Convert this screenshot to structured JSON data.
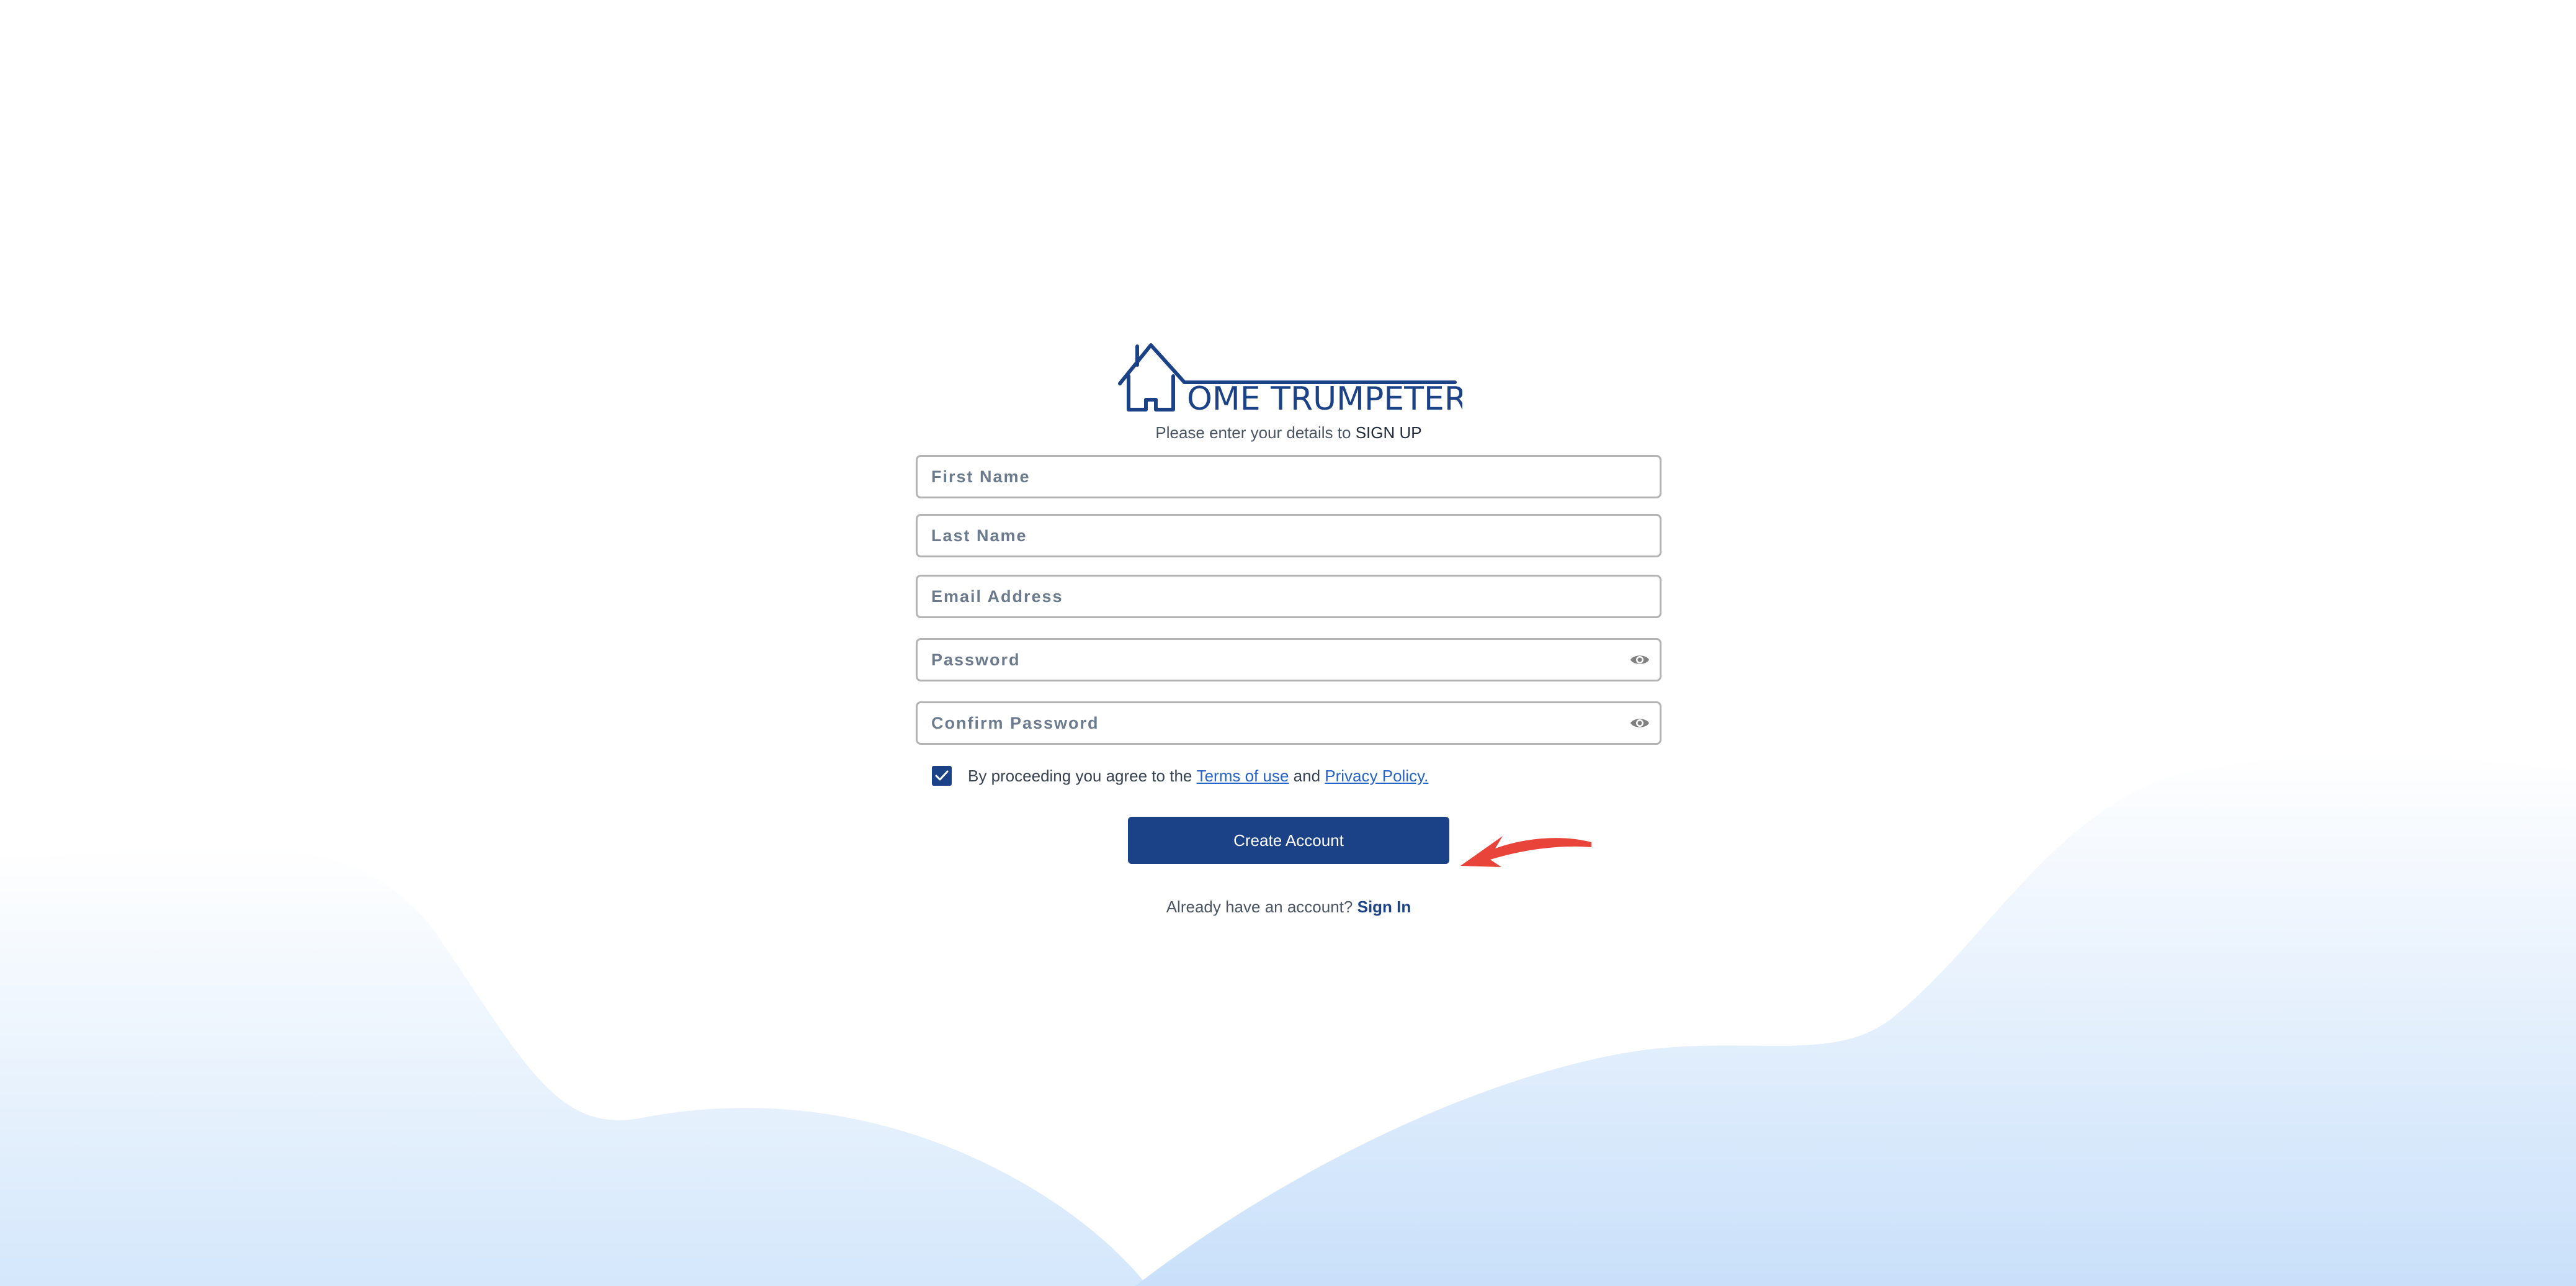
{
  "brand": {
    "name": "OME TRUMPETER",
    "color": "#1b4186"
  },
  "header": {
    "subtitle_prefix": "Please enter your details to",
    "subtitle_action": "SIGN UP"
  },
  "form": {
    "fields": [
      {
        "name": "first-name",
        "placeholder": "First Name",
        "value": "",
        "type": "text"
      },
      {
        "name": "last-name",
        "placeholder": "Last Name",
        "value": "",
        "type": "text"
      },
      {
        "name": "email",
        "placeholder": "Email Address",
        "value": "",
        "type": "email"
      },
      {
        "name": "password",
        "placeholder": "Password",
        "value": "",
        "type": "password",
        "icon": "eye-icon"
      },
      {
        "name": "confirm-password",
        "placeholder": "Confirm Password",
        "value": "",
        "type": "password",
        "icon": "eye-icon"
      }
    ],
    "agree": {
      "checked": true,
      "prefix": "By proceeding you agree to the",
      "terms_link": "Terms of use",
      "and": "and",
      "privacy_link": "Privacy Policy."
    },
    "submit_label": "Create Account"
  },
  "footer": {
    "prompt": "Already have an account?",
    "signin_link": "Sign In"
  },
  "annotation": {
    "type": "arrow",
    "color": "#e8443a",
    "points_to": "Create Account"
  }
}
